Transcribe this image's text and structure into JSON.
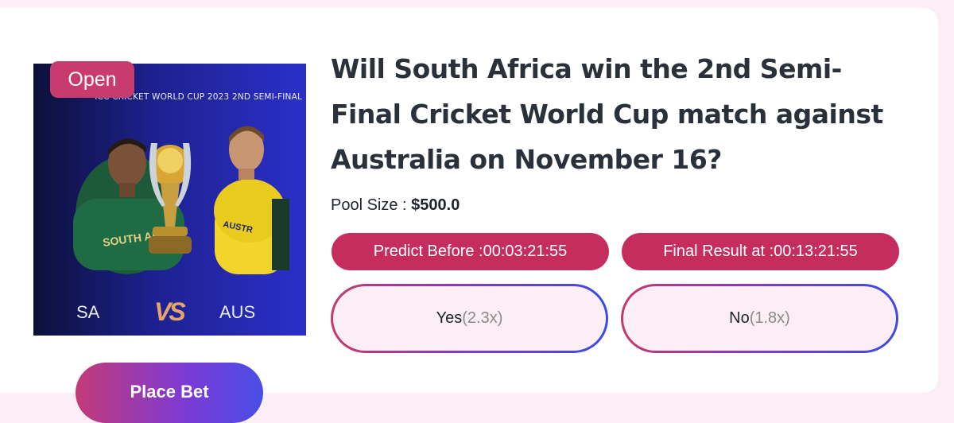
{
  "status_badge": "Open",
  "banner": {
    "title": "ICC CRICKET WORLD CUP 2023 2ND SEMI-FINAL",
    "team_left": "SA",
    "vs": "VS",
    "team_right": "AUS"
  },
  "question": "Will South Africa win the 2nd Semi-Final Cricket World Cup match against Australia on November 16?",
  "pool": {
    "label": "Pool Size : ",
    "amount": "$500.0"
  },
  "predict_before": "Predict Before :00:03:21:55",
  "final_result": "Final Result at :00:13:21:55",
  "options": [
    {
      "label": "Yes",
      "multiplier": "(2.3x)"
    },
    {
      "label": "No",
      "multiplier": "(1.8x)"
    }
  ],
  "place_bet_label": "Place Bet",
  "colors": {
    "accent": "#c52d5f",
    "page_bg": "#fbeef5",
    "text_dark": "#2b313a"
  }
}
